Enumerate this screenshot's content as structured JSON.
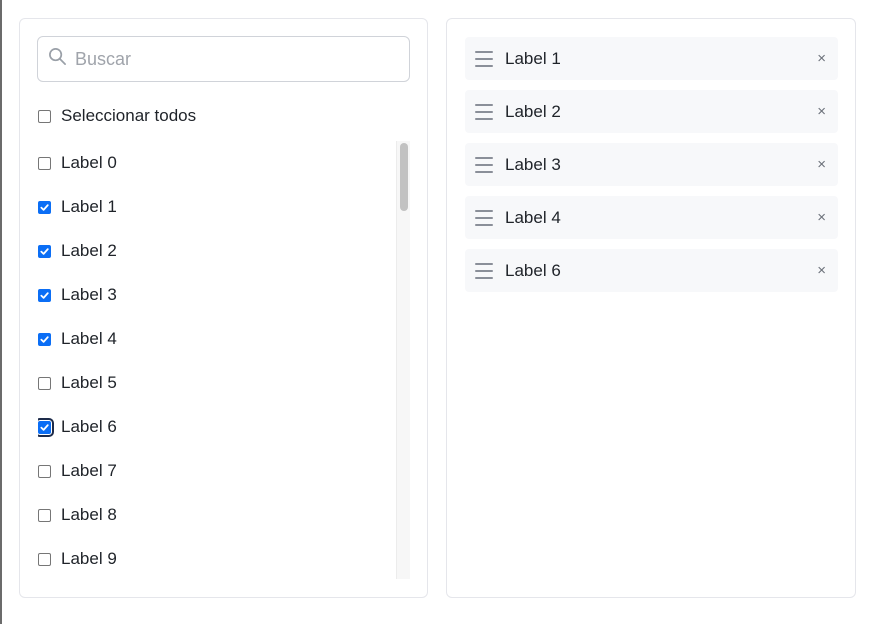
{
  "search": {
    "placeholder": "Buscar",
    "value": ""
  },
  "select_all": {
    "label": "Seleccionar todos",
    "checked": false
  },
  "options": [
    {
      "label": "Label 0",
      "checked": false
    },
    {
      "label": "Label 1",
      "checked": true
    },
    {
      "label": "Label 2",
      "checked": true
    },
    {
      "label": "Label 3",
      "checked": true
    },
    {
      "label": "Label 4",
      "checked": true
    },
    {
      "label": "Label 5",
      "checked": false
    },
    {
      "label": "Label 6",
      "checked": true,
      "focused": true
    },
    {
      "label": "Label 7",
      "checked": false
    },
    {
      "label": "Label 8",
      "checked": false
    },
    {
      "label": "Label 9",
      "checked": false
    }
  ],
  "selected": [
    {
      "label": "Label 1",
      "remove": "×"
    },
    {
      "label": "Label 2",
      "remove": "×"
    },
    {
      "label": "Label 3",
      "remove": "×"
    },
    {
      "label": "Label 4",
      "remove": "×"
    },
    {
      "label": "Label 6",
      "remove": "×"
    }
  ],
  "colors": {
    "accent": "#0b6ef5",
    "chip_bg": "#f7f8fa",
    "border": "#e5e6eb"
  },
  "icons": {
    "search": "search-icon",
    "drag": "drag-handle-icon",
    "remove": "close-icon",
    "check": "check-icon"
  }
}
